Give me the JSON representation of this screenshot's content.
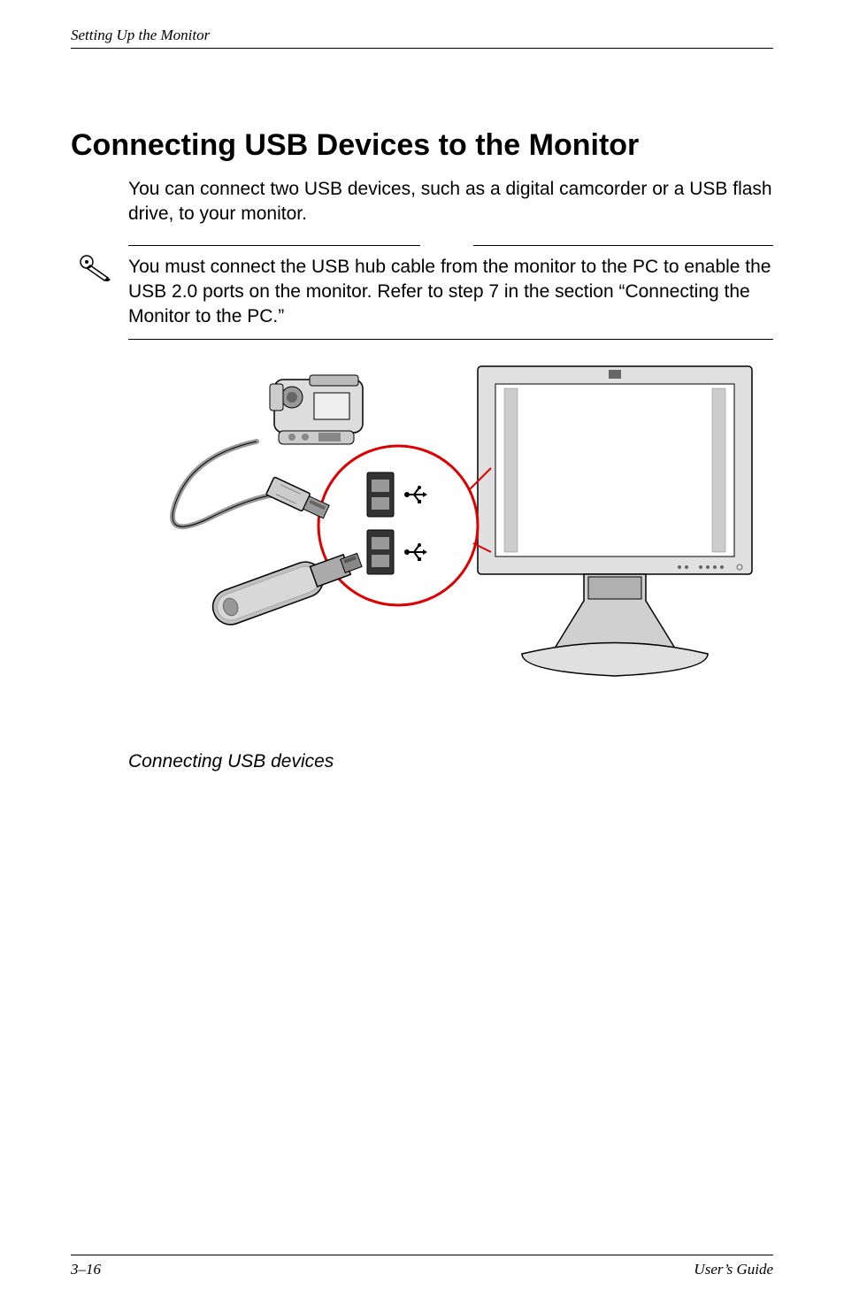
{
  "header": {
    "section_title": "Setting Up the Monitor"
  },
  "content": {
    "heading": "Connecting USB Devices to the Monitor",
    "intro": "You can connect two USB devices, such as a digital camcorder or a USB flash drive, to your monitor.",
    "note": "You must connect the USB hub cable from the monitor to the PC to enable the USB 2.0 ports on the monitor. Refer to step 7 in the section “Connecting the Monitor to the PC.”",
    "figure_caption": "Connecting USB devices"
  },
  "footer": {
    "page_number": "3–16",
    "doc_label": "User’s Guide"
  }
}
